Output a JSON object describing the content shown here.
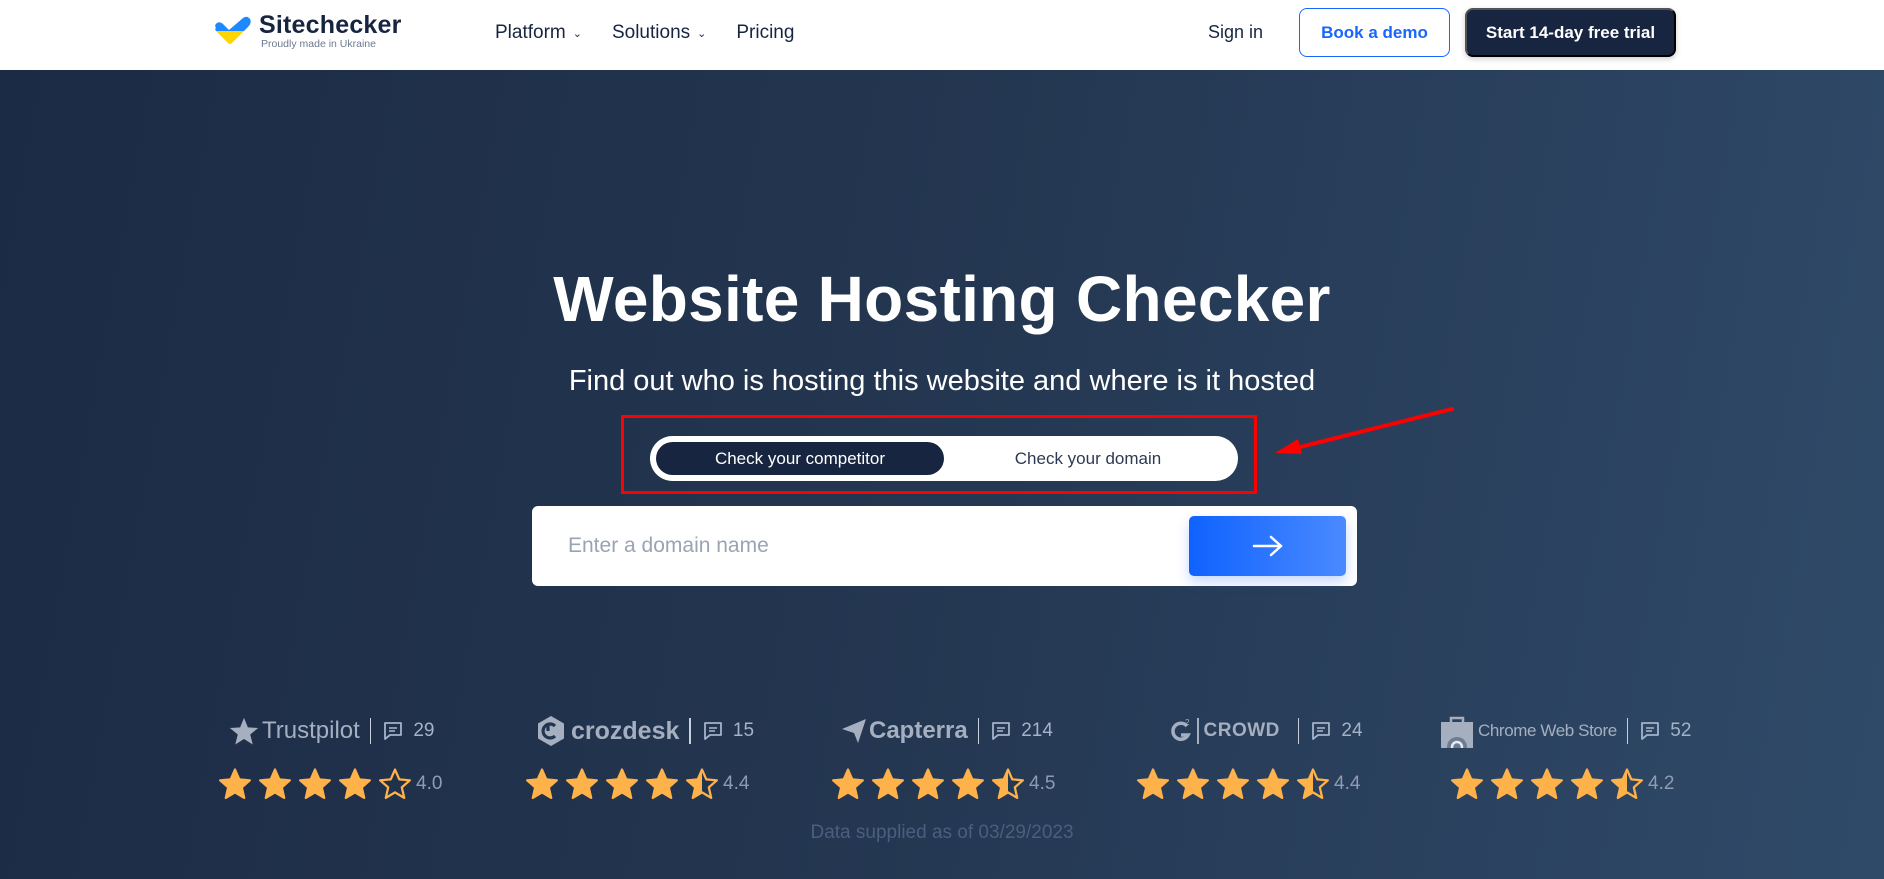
{
  "header": {
    "logo": {
      "name": "Sitechecker",
      "tagline": "Proudly made in Ukraine"
    },
    "nav": [
      {
        "label": "Platform",
        "has_dropdown": true
      },
      {
        "label": "Solutions",
        "has_dropdown": true
      },
      {
        "label": "Pricing",
        "has_dropdown": false
      }
    ],
    "sign_in": "Sign in",
    "book_demo": "Book a demo",
    "start_trial": "Start 14-day free trial"
  },
  "hero": {
    "title": "Website Hosting Checker",
    "subtitle": "Find out who is hosting this website and where is it hosted",
    "toggle": {
      "options": [
        "Check your competitor",
        "Check your domain"
      ],
      "active_index": 0
    },
    "search": {
      "placeholder": "Enter a domain name",
      "value": "",
      "submit_icon": "arrow-right-icon"
    }
  },
  "annotation": {
    "color": "#ff0000",
    "type": "highlight-box-with-arrow"
  },
  "ratings": [
    {
      "platform": "Trustpilot",
      "reviews": "29",
      "score": "4.0",
      "rating": 4.0
    },
    {
      "platform": "crozdesk",
      "reviews": "15",
      "score": "4.4",
      "rating": 4.4
    },
    {
      "platform": "Capterra",
      "reviews": "214",
      "score": "4.5",
      "rating": 4.5
    },
    {
      "platform": "CROWD",
      "reviews": "24",
      "score": "4.4",
      "rating": 4.4
    },
    {
      "platform": "Chrome Web Store",
      "reviews": "52",
      "score": "4.2",
      "rating": 4.2
    }
  ],
  "footnote": "Data supplied as of 03/29/2023",
  "colors": {
    "brand_dark": "#172540",
    "accent_blue": "#1866ff",
    "star": "#ffb14a",
    "logo_blue": "#1e88ff",
    "logo_yellow": "#ffd500"
  }
}
